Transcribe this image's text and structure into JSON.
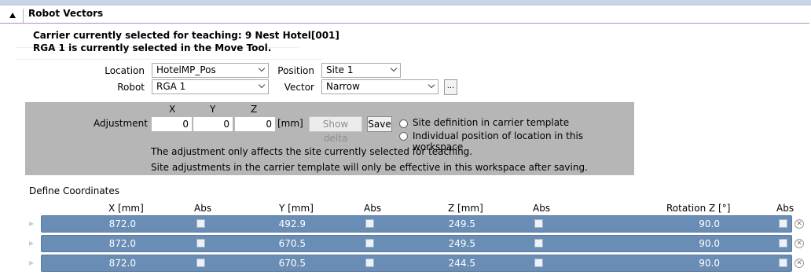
{
  "section": {
    "title": "Robot Vectors"
  },
  "info": {
    "carrier": "Carrier currently selected for teaching: 9 Nest Hotel[001]",
    "rga": "RGA 1 is currently selected in the Move Tool."
  },
  "form": {
    "location_label": "Location",
    "location_value": "HotelMP_Pos",
    "position_label": "Position",
    "position_value": "Site 1",
    "robot_label": "Robot",
    "robot_value": "RGA 1",
    "vector_label": "Vector",
    "vector_value": "Narrow",
    "browse_label": "..."
  },
  "adjustment": {
    "label": "Adjustment",
    "x_header": "X",
    "y_header": "Y",
    "z_header": "Z",
    "x": "0",
    "y": "0",
    "z": "0",
    "unit": "[mm]",
    "show_delta": "Show delta",
    "save": "Save",
    "radio1": "Site definition in carrier template",
    "radio2": "Individual position of location in this workspace",
    "note1": "The adjustment only affects the site currently selected for teaching.",
    "note2": "Site adjustments in the carrier template will only be effective in this workspace after saving."
  },
  "coords": {
    "title": "Define Coordinates",
    "headers": {
      "x": "X [mm]",
      "abs1": "Abs",
      "y": "Y [mm]",
      "abs2": "Abs",
      "z": "Z [mm]",
      "abs3": "Abs",
      "rot": "Rotation Z [°]",
      "abs4": "Abs"
    },
    "rows": [
      {
        "x": "872.0",
        "y": "492.9",
        "z": "249.5",
        "rot": "90.0"
      },
      {
        "x": "872.0",
        "y": "670.5",
        "z": "249.5",
        "rot": "90.0"
      },
      {
        "x": "872.0",
        "y": "670.5",
        "z": "244.5",
        "rot": "90.0"
      }
    ]
  },
  "icons": {
    "collapse": "collapse-triangle-icon",
    "dropdown": "chevron-down-icon",
    "checkbox": "checkbox-icon",
    "delete": "delete-circle-icon",
    "row_expand": "row-expand-arrow-icon"
  },
  "colors": {
    "accent_line": "#b389c7",
    "panel_grey": "#b6b6b6",
    "row_blue": "#6a8db5"
  }
}
